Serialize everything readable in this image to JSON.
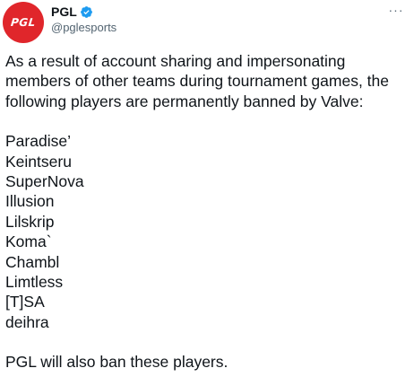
{
  "tweet": {
    "author": {
      "display_name": "PGL",
      "handle": "@pglesports",
      "avatar_text": "PGL",
      "avatar_color": "#e0262b",
      "verified": true,
      "verified_color": "#1d9bf0"
    },
    "more_label": "···",
    "text": {
      "intro_line_1": "As a result of account sharing and impersonating",
      "intro_line_2": "members of other teams during tournament games, the",
      "intro_line_3": "following players are permanently banned by Valve:",
      "players": [
        "Paradise’",
        "Keintseru",
        "SuperNova",
        "Illusion",
        "Lilskrip",
        "Koma`",
        "Chambl",
        "Limtless",
        "[T]SA",
        "deihra"
      ],
      "closing": "PGL will also ban these players."
    }
  }
}
